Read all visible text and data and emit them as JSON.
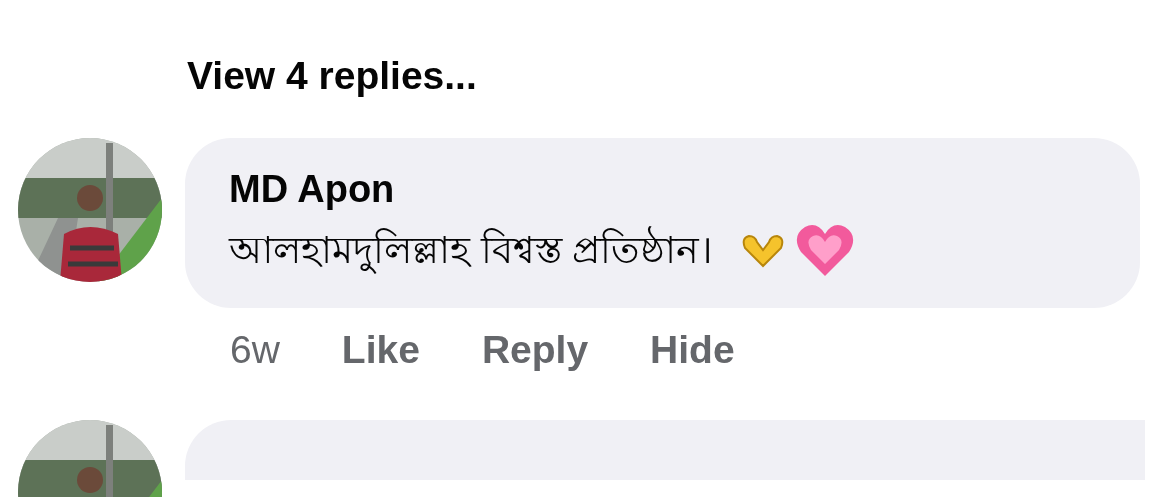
{
  "view_replies": "View 4 replies...",
  "comments": [
    {
      "author": "MD Apon",
      "text": "আলহামদুলিল্লাহ বিশ্বস্ত প্রতিষ্ঠান।",
      "time": "6w",
      "actions": [
        "Like",
        "Reply",
        "Hide"
      ]
    }
  ]
}
